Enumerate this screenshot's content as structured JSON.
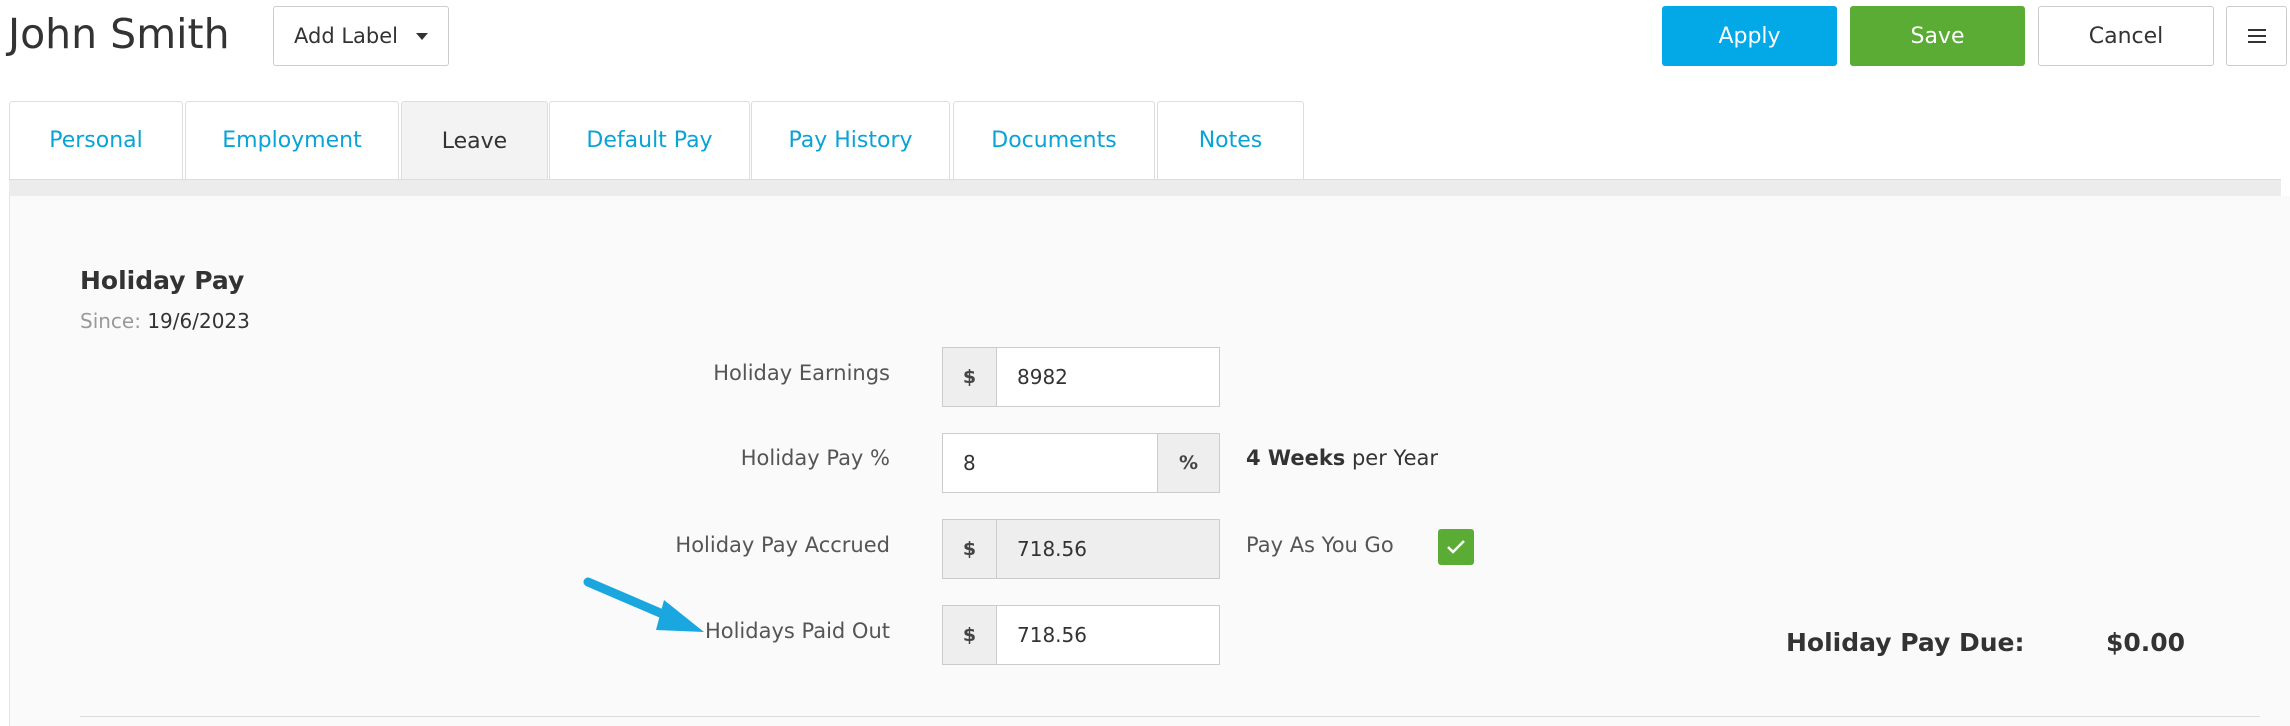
{
  "header": {
    "employee_name": "John Smith",
    "add_label": "Add Label",
    "apply_label": "Apply",
    "save_label": "Save",
    "cancel_label": "Cancel"
  },
  "tabs": [
    {
      "label": "Personal"
    },
    {
      "label": "Employment"
    },
    {
      "label": "Leave",
      "active": true
    },
    {
      "label": "Default Pay"
    },
    {
      "label": "Pay History"
    },
    {
      "label": "Documents"
    },
    {
      "label": "Notes"
    }
  ],
  "holiday_pay": {
    "title": "Holiday Pay",
    "since_label": "Since:",
    "since_value": "19/6/2023",
    "fields": {
      "earnings": {
        "label": "Holiday Earnings",
        "prefix": "$",
        "value": "8982"
      },
      "percent": {
        "label": "Holiday Pay %",
        "suffix": "%",
        "value": "8"
      },
      "accrued": {
        "label": "Holiday Pay Accrued",
        "prefix": "$",
        "value": "718.56"
      },
      "paid_out": {
        "label": "Holidays Paid Out",
        "prefix": "$",
        "value": "718.56"
      }
    },
    "weeks_bold": "4 Weeks",
    "weeks_rest": " per Year",
    "pay_as_you_go_label": "Pay As You Go",
    "pay_as_you_go_checked": true,
    "due_label": "Holiday Pay Due:",
    "due_value": "$0.00"
  },
  "colors": {
    "apply": "#03a9e6",
    "save": "#5aac35",
    "tab_link": "#0aa3d6",
    "annotation_arrow": "#1aa7df"
  },
  "icons": [
    "chevron-down-icon",
    "hamburger-menu-icon",
    "checkmark-icon",
    "annotation-arrow-icon"
  ]
}
